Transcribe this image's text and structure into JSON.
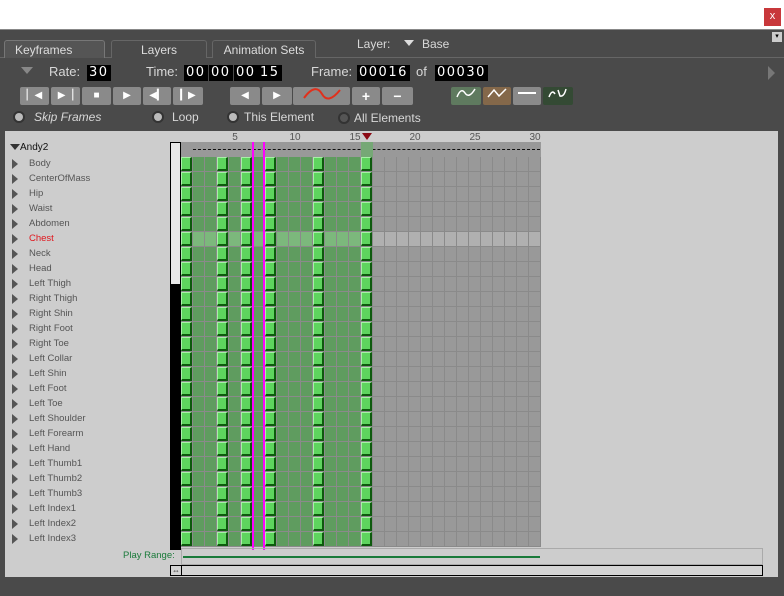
{
  "window": {
    "close_label": "x"
  },
  "tabs": [
    "Keyframes",
    "Layers",
    "Animation Sets"
  ],
  "layer": {
    "label": "Layer:",
    "value": "Base"
  },
  "controls": {
    "rate_label": "Rate:",
    "rate": "30",
    "time_label": "Time:",
    "time": [
      "00",
      "00",
      "00",
      "15"
    ],
    "frame_label": "Frame:",
    "frame": "00016",
    "of_label": "of",
    "total": "00030"
  },
  "options": {
    "skip_frames": "Skip Frames",
    "loop": "Loop",
    "this_element": "This Element",
    "all_elements": "All Elements"
  },
  "tree": {
    "root": "Andy2",
    "bones": [
      "Body",
      "CenterOfMass",
      "Hip",
      "Waist",
      "Abdomen",
      "Chest",
      "Neck",
      "Head",
      "Left Thigh",
      "Right Thigh",
      "Right Shin",
      "Right Foot",
      "Right Toe",
      "Left Collar",
      "Left Shin",
      "Left Foot",
      "Left Toe",
      "Left Shoulder",
      "Left Forearm",
      "Left Hand",
      "Left Thumb1",
      "Left Thumb2",
      "Left Thumb3",
      "Left Index1",
      "Left Index2",
      "Left Index3"
    ],
    "selected": "Chest"
  },
  "timeline": {
    "total_frames": 30,
    "current_frame": 16,
    "keyframes": [
      1,
      4,
      6,
      8,
      12,
      16
    ],
    "tick_labels": [
      "5",
      "10",
      "15",
      "20",
      "25",
      "30"
    ],
    "play_range_label": "Play Range:",
    "play_range": [
      1,
      30
    ],
    "marker_frames": [
      7
    ]
  },
  "colors": {
    "key": "#5ed45e",
    "selected_bone": "#e0151c",
    "playhead": "#8b0a14",
    "marker": "#ff00ff",
    "play_range": "#1a7a3a"
  }
}
